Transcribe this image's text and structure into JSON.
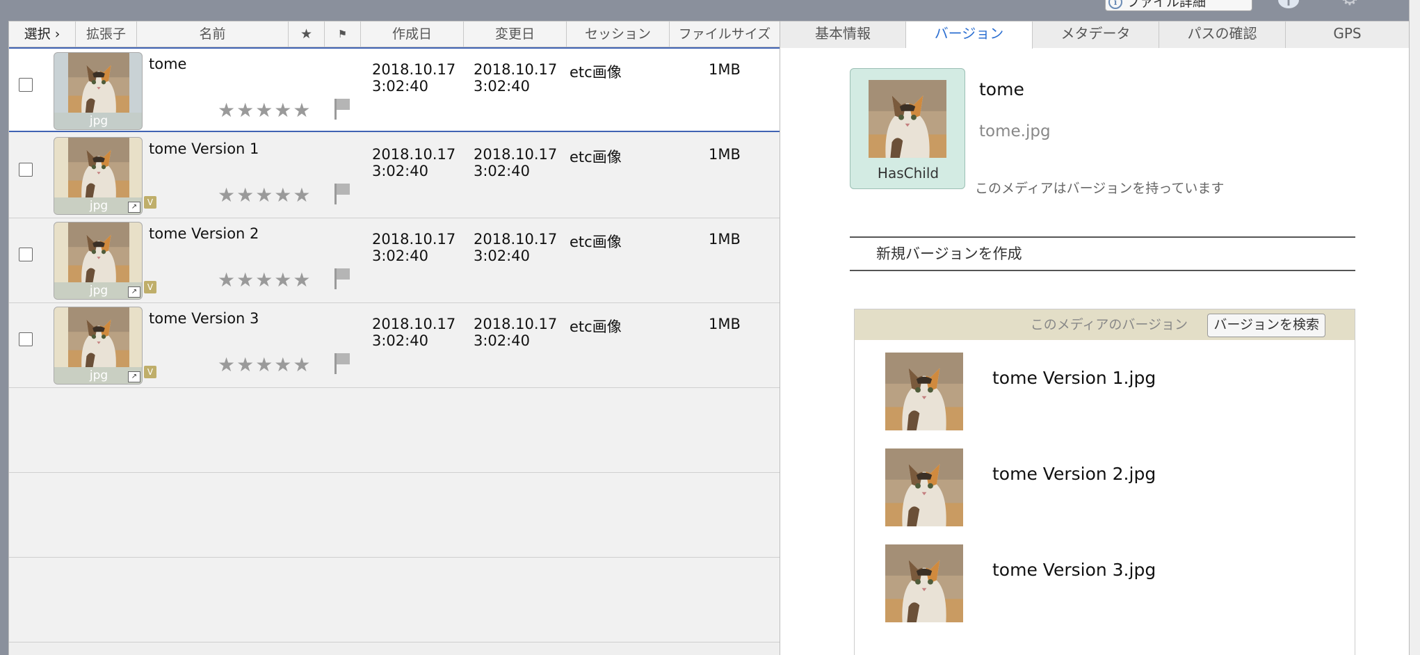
{
  "topbar": {
    "file_detail_label": "ファイル詳細"
  },
  "list": {
    "headers": [
      "選択",
      "拡張子",
      "名前",
      "★",
      "⚑",
      "作成日",
      "変更日",
      "セッション",
      "ファイルサイズ"
    ],
    "rows": [
      {
        "name": "tome",
        "ext": "jpg",
        "created_date": "2018.10.17",
        "created_time": "3:02:40",
        "modified_date": "2018.10.17",
        "modified_time": "3:02:40",
        "session": "etc画像",
        "size": "1MB",
        "stars": "★★★★★",
        "is_version": false
      },
      {
        "name": "tome Version 1",
        "ext": "jpg",
        "created_date": "2018.10.17",
        "created_time": "3:02:40",
        "modified_date": "2018.10.17",
        "modified_time": "3:02:40",
        "session": "etc画像",
        "size": "1MB",
        "stars": "★★★★★",
        "is_version": true,
        "badge": "V"
      },
      {
        "name": "tome Version 2",
        "ext": "jpg",
        "created_date": "2018.10.17",
        "created_time": "3:02:40",
        "modified_date": "2018.10.17",
        "modified_time": "3:02:40",
        "session": "etc画像",
        "size": "1MB",
        "stars": "★★★★★",
        "is_version": true,
        "badge": "V"
      },
      {
        "name": "tome Version 3",
        "ext": "jpg",
        "created_date": "2018.10.17",
        "created_time": "3:02:40",
        "modified_date": "2018.10.17",
        "modified_time": "3:02:40",
        "session": "etc画像",
        "size": "1MB",
        "stars": "★★★★★",
        "is_version": true,
        "badge": "V"
      }
    ]
  },
  "detail": {
    "tabs": [
      {
        "label": "基本情報",
        "active": false
      },
      {
        "label": "バージョン",
        "active": true
      },
      {
        "label": "メタデータ",
        "active": false
      },
      {
        "label": "パスの確認",
        "active": false
      },
      {
        "label": "GPS",
        "active": false
      }
    ],
    "card_label": "HasChild",
    "title": "tome",
    "filename": "tome.jpg",
    "note": "このメディアはバージョンを持っています",
    "create_version_label": "新規バージョンを作成",
    "versions_caption": "このメディアのバージョン",
    "search_versions_label": "バージョンを検索",
    "versions": [
      "tome Version 1.jpg",
      "tome Version 2.jpg",
      "tome Version 3.jpg"
    ]
  },
  "colors": {
    "accent": "#2c6fd1",
    "selection_border": "#3f62b3",
    "card_bg": "#d3ebe3",
    "version_header_bg": "#e3dec7",
    "badge": "#bfae6a"
  }
}
